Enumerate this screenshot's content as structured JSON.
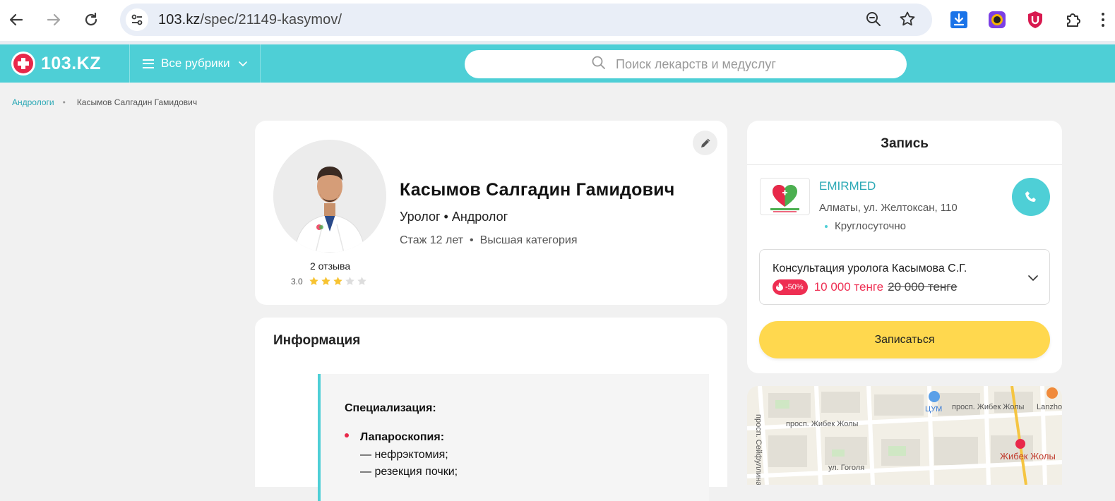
{
  "browser": {
    "url_host": "103.kz",
    "url_path": "/spec/21149-kasymov/"
  },
  "header": {
    "logo_text": "103.KZ",
    "rubrics_label": "Все рубрики",
    "search_placeholder": "Поиск лекарств и медуслуг",
    "brand_color": "#4ecfd6"
  },
  "breadcrumb": {
    "parent": "Андрологи",
    "current": "Касымов Салгадин Гамидович"
  },
  "doctor": {
    "name": "Касымов Салгадин Гамидович",
    "specialties": "Уролог • Андролог",
    "experience": "Стаж 12 лет",
    "category": "Высшая категория",
    "reviews": "2 отзыва",
    "rating": "3.0",
    "rating_value": 3,
    "rating_max": 5
  },
  "info": {
    "title": "Информация",
    "specialization_label": "Специализация:",
    "procedure_title": "Лапароскопия:",
    "procedure_items": [
      "— нефрэктомия;",
      "— резекция почки;"
    ]
  },
  "booking": {
    "title": "Запись",
    "clinic_name": "EMIRMED",
    "clinic_address": "Алматы, ул. Желтоксан, 110",
    "clinic_hours": "Круглосуточно",
    "service_name": "Консультация уролога Касымова С.Г.",
    "discount_badge": "-50%",
    "price_new": "10 000 тенге",
    "price_old": "20 000 тенге",
    "book_button": "Записаться",
    "accent_red": "#ee2e52",
    "button_yellow": "#ffd84e"
  },
  "map": {
    "labels": [
      "просп. Жибек Жолы",
      "просп. Жибек Жолы",
      "ЦУМ",
      "Lanzhou",
      "Жибек Жолы",
      "ул. Гоголя",
      "просп. Сейфуллина"
    ]
  }
}
